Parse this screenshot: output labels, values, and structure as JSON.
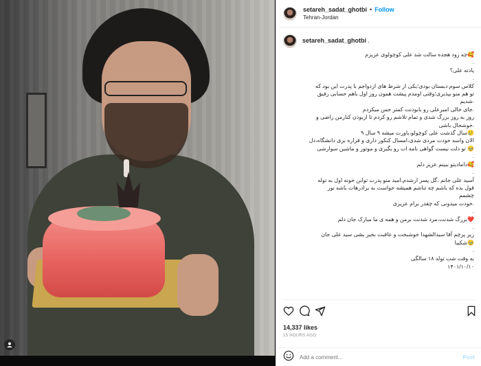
{
  "header": {
    "username": "setareh_sadat_ghotbi",
    "separator": "•",
    "follow_label": "Follow",
    "location": "Tehran-Jordan"
  },
  "caption": {
    "username": "setareh_sadat_ghotbi",
    "username_suffix": ".",
    "lines": [
      "🥰چه زود هجده سالت شد علی کوچولوی عزیزم",
      ".",
      "یادته علی؟",
      ".",
      "کلاس سوم دبستان بودی؛یکی از شرط های ازدواجم با پدرت این بود که",
      "تو هم منو بپذیری؛وقتی اومدم پیشت همون روز اول باهم حسابی رفیق",
      ".شدیم",
      ".جای خالی امیرعلی رو بابودنت کمتر حس میکردم",
      "روز به روز بزرگ شدی و تمام تلاشم رو کردم تا ازبودن کنارمن راضی و",
      ".خوشحال باشی",
      "🥲سال گذشت علی کوچولو،باورت میشه ۹ سال ۹",
      "الان واسه خودت مردی شدی،امسال کنکور داری و قراره بری دانشگاه،دل",
      "🥹 تو دلت نیست گواهی نامه ات رو بگیری و موتور و ماشین سوارشی",
      ".",
      "🥰داماد‌یتو ببینم عزیز دلم",
      ".",
      "آسید علی جانم ،گل پسر ارشدم،امید منو پدرت توابن خونه اول به توله",
      "قول بده که باشم چه تناشم همیشه حواست به برادرهات باشه نور",
      "چشمم",
      ".خودت میدونی که چقدر برام عزیزی",
      ".",
      "❤️بزرگ شدنت،مرد شدنت برمن و همه ی ما مبارک جان دلم",
      ".",
      "زیر پرچم آقا سیدالشهدا خوشبخت و عاقبت بخیر بشی سید علی جان",
      "🥹شکیبا",
      ".",
      "به وقت شب تولد ۱۸ سالگی"
    ],
    "date": "۱۴۰۱/۱۰/۱۰"
  },
  "actions": {
    "icons": [
      "heart-icon",
      "comment-icon",
      "share-icon",
      "bookmark-icon"
    ]
  },
  "likes": "14,337 likes",
  "time_ago": "15 HOURS AGO",
  "comment": {
    "placeholder": "Add a comment...",
    "post_label": "Post"
  },
  "colors": {
    "accent": "#0095f6",
    "post_disabled": "#b2dffc",
    "text": "#262626",
    "muted": "#8e8e8e"
  }
}
